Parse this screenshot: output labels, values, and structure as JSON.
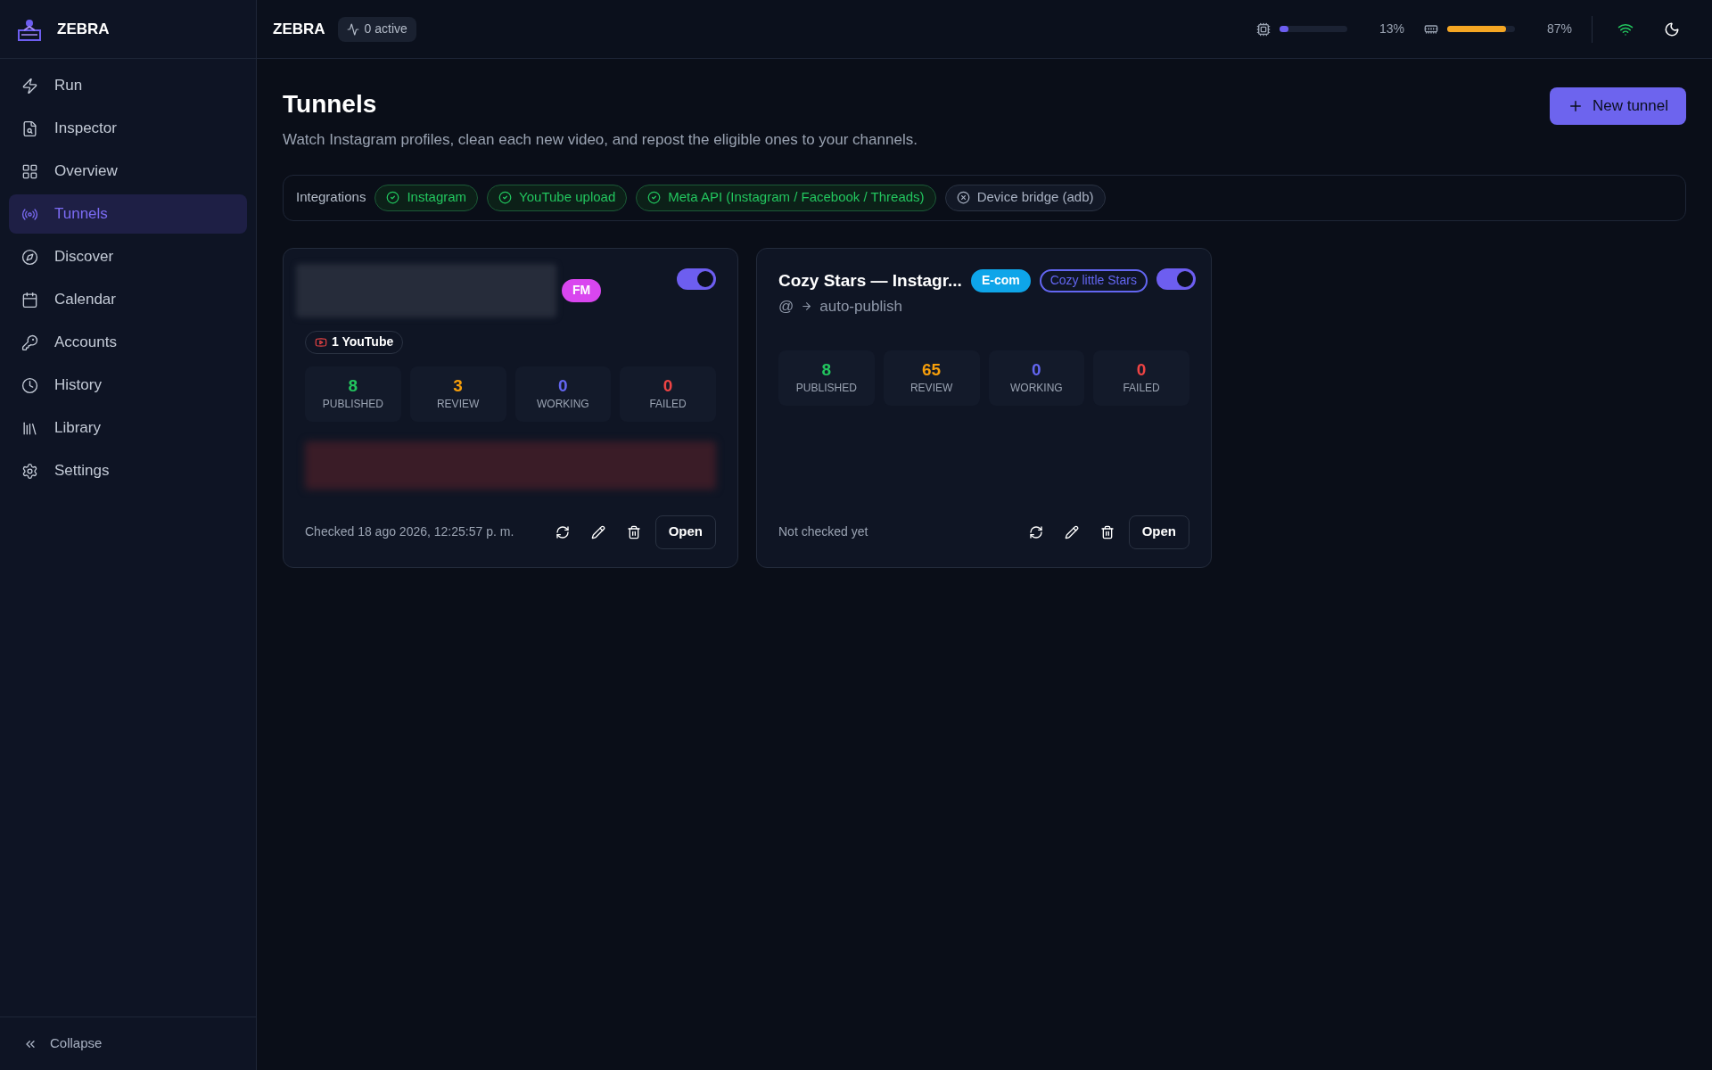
{
  "sidebar": {
    "brand": "ZEBRA",
    "items": [
      {
        "label": "Run",
        "selected": false
      },
      {
        "label": "Inspector",
        "selected": false
      },
      {
        "label": "Overview",
        "selected": false
      },
      {
        "label": "Tunnels",
        "selected": true
      },
      {
        "label": "Discover",
        "selected": false
      },
      {
        "label": "Calendar",
        "selected": false
      },
      {
        "label": "Accounts",
        "selected": false
      },
      {
        "label": "History",
        "selected": false
      },
      {
        "label": "Library",
        "selected": false
      },
      {
        "label": "Settings",
        "selected": false
      }
    ],
    "collapse": "Collapse"
  },
  "topbar": {
    "title": "ZEBRA",
    "activity": "0 active",
    "cpu": {
      "level": 0.13,
      "reading": "13%"
    },
    "memory": {
      "level": 0.87,
      "reading": "87%"
    }
  },
  "page": {
    "title": "Tunnels",
    "subtitle": "Watch Instagram profiles, clean each new video, and repost the eligible ones to your channels.",
    "new_button": "New tunnel"
  },
  "integrations": {
    "label": "Integrations",
    "items": [
      {
        "label": "Instagram",
        "ok": true
      },
      {
        "label": "YouTube upload",
        "ok": true
      },
      {
        "label": "Meta API (Instagram / Facebook / Threads)",
        "ok": true
      },
      {
        "label": "Device bridge (adb)",
        "ok": false
      }
    ]
  },
  "tunnels": [
    {
      "redacted_title": true,
      "tags": [
        {
          "label": "FM",
          "kind": "solid",
          "color": "#d946ef"
        }
      ],
      "enabled": true,
      "channels": [
        "1 YouTube"
      ],
      "stats": [
        {
          "value": "8",
          "label": "PUBLISHED",
          "color": "#22c55e"
        },
        {
          "value": "3",
          "label": "REVIEW",
          "color": "#f59e0b"
        },
        {
          "value": "0",
          "label": "WORKING",
          "color": "#6366f1"
        },
        {
          "value": "0",
          "label": "FAILED",
          "color": "#ef4444"
        }
      ],
      "redacted_notice": true,
      "checked": "Checked 18 ago 2026, 12:25:57 p. m.",
      "open": "Open"
    },
    {
      "title": "Cozy Stars — Instagr...",
      "tags": [
        {
          "label": "E-com",
          "kind": "solid",
          "color": "#0ea5e9"
        },
        {
          "label": "Cozy little Stars",
          "kind": "outline",
          "color": "#6366f1"
        }
      ],
      "enabled": true,
      "source": "@",
      "target": "auto-publish",
      "stats": [
        {
          "value": "8",
          "label": "PUBLISHED",
          "color": "#22c55e"
        },
        {
          "value": "65",
          "label": "REVIEW",
          "color": "#f59e0b"
        },
        {
          "value": "0",
          "label": "WORKING",
          "color": "#6366f1"
        },
        {
          "value": "0",
          "label": "FAILED",
          "color": "#ef4444"
        }
      ],
      "checked": "Not checked yet",
      "open": "Open"
    }
  ]
}
